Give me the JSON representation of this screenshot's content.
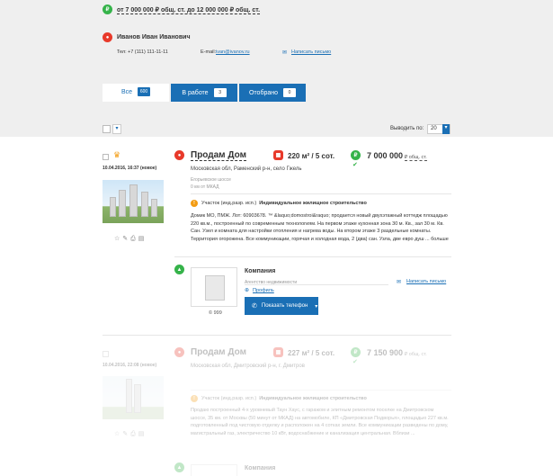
{
  "header": {
    "price_filter": "от 7 000 000 ₽ общ. ст. до 12 000 000 ₽ общ. ст."
  },
  "agent": {
    "name": "Иванов Иван Иванович",
    "phone_label": "Тел:",
    "phone": "+7 (111) 111-11-11",
    "email_label": "E-mail:",
    "email": "ivan@ivanov.ru",
    "write_link": "Написать письмо"
  },
  "tabs": [
    {
      "label": "Все",
      "count": "600"
    },
    {
      "label": "В работе",
      "count": "3"
    },
    {
      "label": "Отобрано",
      "count": "0"
    }
  ],
  "toolbar": {
    "show_by_label": "Выводить по:",
    "show_by_value": "20"
  },
  "listings": [
    {
      "date": "10.04.2016, 16:37 (новое)",
      "title": "Продам Дом",
      "area": "220 м² / 5 сот.",
      "price": "7 000 000",
      "price_unit": "₽ общ. ст.",
      "address": "Московская обл, Раменский р-н, село Гжель",
      "direction": "Егорьевское шоссе",
      "distance": "0 км от МКАД",
      "plot": "Участок (инд.разр. исп.)",
      "plot_type": "Индивидуальное жилищное строительство",
      "description": "Домик МО, ПМЖ. Лот: 60903678. ™ &laquo;domostroi&raquo; продается новый двухэтажный коттедж площадью 220 кв.м., построенный по современным технологиям. На первом этаже кухонная зона 30 м. Кв., зал 30 м. Кв. Сан. Узел и комната для настройки отопления и нагрева воды. На втором этаже 3 раздельные комнаты. Территория огорожена. Все коммуникации, горячая и холодная вода, 2 (два) сан. Узла, две евро душ ... больше",
      "more": "больше",
      "company": "Компания",
      "company_type": "Агентство недвижимости",
      "profile": "Профиль",
      "write": "Написать письмо",
      "phone_btn": "Показать телефон",
      "rating": "999"
    },
    {
      "date": "10.04.2016, 22:08 (новое)",
      "title": "Продам Дом",
      "area": "227 м² / 5 сот.",
      "price": "7 150 900",
      "price_unit": "₽ общ. ст.",
      "address": "Московская обл, Дмитровский р-н, г. Дмитров",
      "plot": "Участок (инд.разр. исп.)",
      "plot_type": "Индивидуальное жилищное строительство",
      "description": "Продаю построенный 4-х уровневый Таун Хаус, с гаражом и элитным ремонтом поселке на Дмитровском шоссе, 35 км. от Москвы (50 минут от МКАД) на автомобиле, КП «Дмитровская Подворья», площадью 227 кв.м. подготовленный под чистовую отделку и расположен на 4 сотках земли. Все коммуникации разведены по дому, магистральный газ, электричество 10 кВт, водоснабжение и канализация центральная. Вблизи ...",
      "more": "больше",
      "company": "Компания"
    }
  ]
}
